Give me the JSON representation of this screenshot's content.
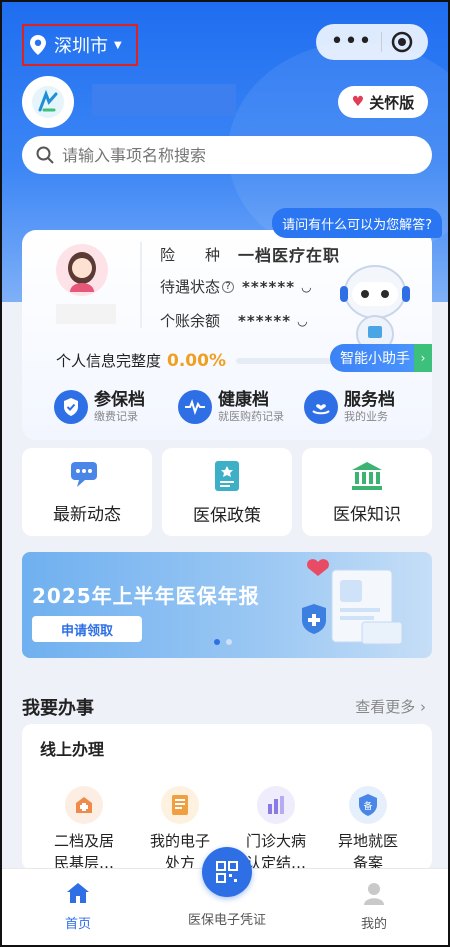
{
  "header": {
    "city": "深圳市",
    "care_label": "关怀版",
    "search_placeholder": "请输入事项名称搜索"
  },
  "assistant_bubble": "请问有什么可以为您解答?",
  "profile": {
    "rows": [
      {
        "label": "险　　种",
        "value": "一档医疗在职"
      },
      {
        "label": "待遇状态",
        "value": "******"
      },
      {
        "label": "个账余额",
        "value": "******"
      }
    ],
    "completeness_label": "个人信息完整度",
    "completeness_value": "0.00%",
    "assistant_label": "智能小助手",
    "quick_links": [
      {
        "title": "参保档",
        "subtitle": "缴费记录",
        "icon": "shield-check-icon"
      },
      {
        "title": "健康档",
        "subtitle": "就医购药记录",
        "icon": "pulse-icon"
      },
      {
        "title": "服务档",
        "subtitle": "我的业务",
        "icon": "hand-heart-icon"
      }
    ]
  },
  "tiles": [
    {
      "label": "最新动态",
      "icon": "chat-icon"
    },
    {
      "label": "医保政策",
      "icon": "policy-book-icon"
    },
    {
      "label": "医保知识",
      "icon": "institution-icon"
    }
  ],
  "banner": {
    "title": "2025年上半年医保年报",
    "button": "申请领取"
  },
  "section": {
    "title": "我要办事",
    "more": "查看更多"
  },
  "online": {
    "title": "线上办理",
    "items": [
      {
        "label_line1": "二档及居",
        "label_line2": "民基层…",
        "icon": "hospital-icon",
        "color": "#f08a4b"
      },
      {
        "label_line1": "我的电子",
        "label_line2": "处方",
        "icon": "prescription-icon",
        "color": "#f0a040"
      },
      {
        "label_line1": "门诊大病",
        "label_line2": "认定结…",
        "icon": "bar-chart-icon",
        "color": "#8a7ae6"
      },
      {
        "label_line1": "异地就医",
        "label_line2": "备案",
        "icon": "badge-icon",
        "color": "#4a86e8"
      }
    ]
  },
  "tabbar": {
    "home": "首页",
    "qr": "医保电子凭证",
    "mine": "我的"
  },
  "colors": {
    "primary": "#2f6fe6",
    "accent_orange": "#f0a020",
    "highlight_border": "#dd2222"
  }
}
